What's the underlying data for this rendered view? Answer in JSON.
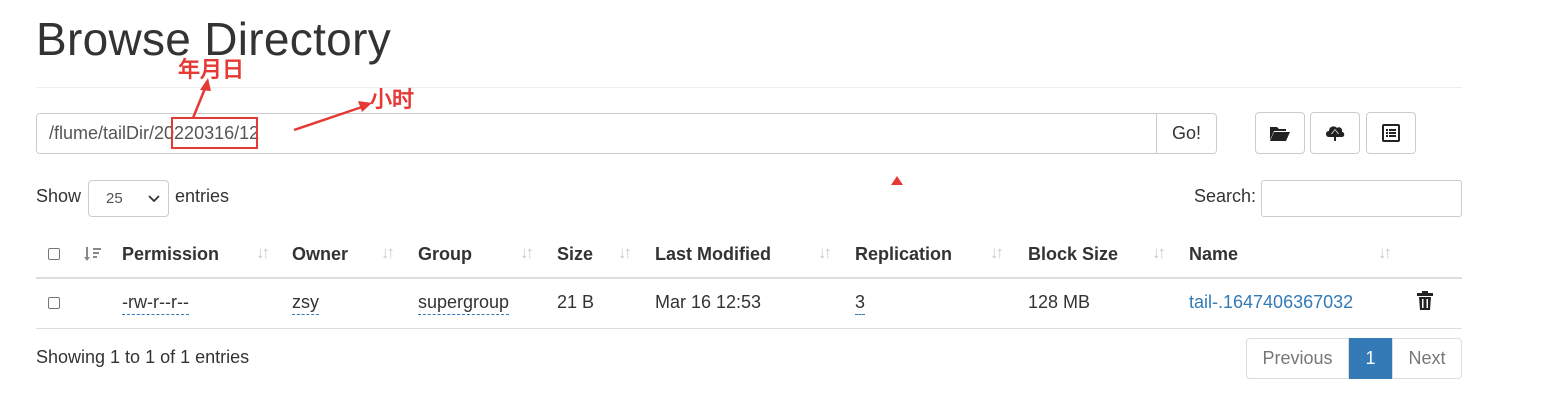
{
  "page": {
    "title": "Browse Directory"
  },
  "path_bar": {
    "value": "/flume/tailDir/20220316/12",
    "go_label": "Go!"
  },
  "toolbar": {
    "icons": [
      "folder-open-icon",
      "cloud-upload-icon",
      "list-alt-icon"
    ]
  },
  "annotations": {
    "date_label": "年月日",
    "hour_label": "小时",
    "color": "#e53935"
  },
  "length_control": {
    "show_label": "Show",
    "selected": "25",
    "entries_label": "entries"
  },
  "search": {
    "label": "Search:",
    "value": ""
  },
  "table": {
    "columns": [
      "Permission",
      "Owner",
      "Group",
      "Size",
      "Last Modified",
      "Replication",
      "Block Size",
      "Name"
    ],
    "rows": [
      {
        "permission": "-rw-r--r--",
        "owner": "zsy",
        "group": "supergroup",
        "size": "21 B",
        "last_modified": "Mar 16 12:53",
        "replication": "3",
        "block_size": "128 MB",
        "name": "tail-.1647406367032"
      }
    ]
  },
  "footer": {
    "info": "Showing 1 to 1 of 1 entries",
    "pagination": {
      "previous": "Previous",
      "current": "1",
      "next": "Next"
    }
  },
  "colors": {
    "link": "#337ab7",
    "active_page": "#337ab7",
    "annotation": "#e53935"
  }
}
